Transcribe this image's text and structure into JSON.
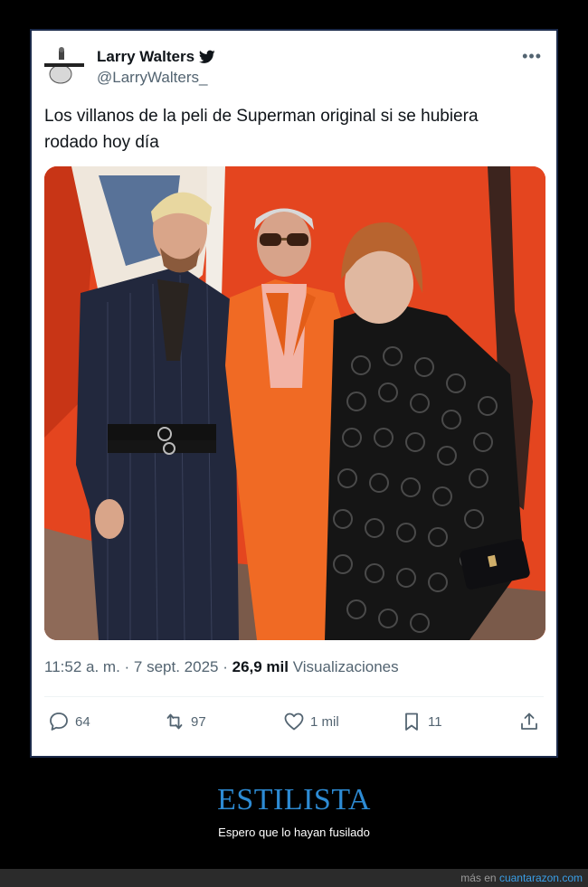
{
  "tweet": {
    "author_name": "Larry Walters",
    "author_handle": "@LarryWalters_",
    "text": "Los villanos de la peli de Superman original si se hubiera rodado hoy día",
    "time": "11:52 a. m.",
    "date": "7 sept. 2025",
    "views_count": "26,9 mil",
    "views_label": "Visualizaciones",
    "replies": "64",
    "retweets": "97",
    "likes": "1 mil",
    "bookmarks": "11"
  },
  "caption": {
    "title": "ESTILISTA",
    "subtitle": "Espero que lo hayan fusilado"
  },
  "footer": {
    "prefix": "más en",
    "site": "cuantarazon.com"
  },
  "colors": {
    "verified": "#0f1419",
    "caption_title": "#2d8bd4",
    "link": "#3a9ee6",
    "card_border": "#1b2a4a"
  }
}
